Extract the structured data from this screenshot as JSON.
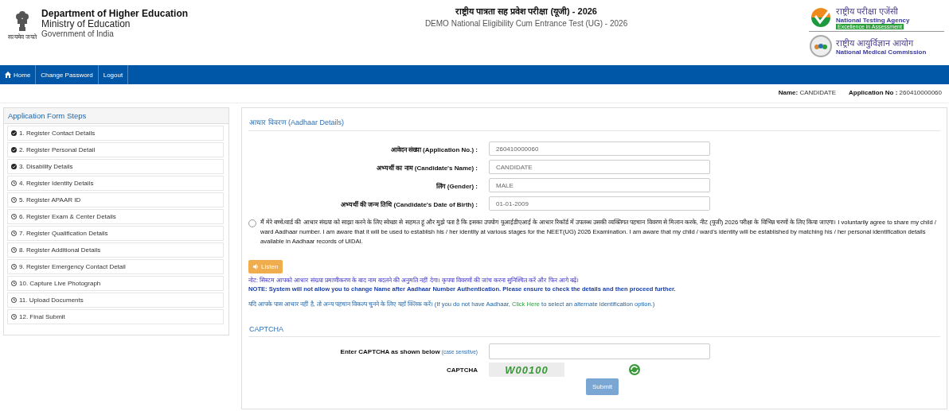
{
  "header": {
    "emblem_caption": "सत्यमेव जयते",
    "department": "Department of Higher Education",
    "ministry": "Ministry of Education",
    "government": "Government of India",
    "title_hindi": "राष्ट्रीय पात्रता सह प्रवेश परीक्षा (यूजी) - 2026",
    "title_english": "DEMO National Eligibility Cum Entrance Test (UG) - 2026",
    "nta": {
      "hindi": "राष्ट्रीय परीक्षा एजेंसी",
      "english": "National Testing Agency",
      "tagline": "Excellence in Assessment"
    },
    "nmc": {
      "hindi": "राष्ट्रीय आयुर्विज्ञान आयोग",
      "english": "National Medical Commission"
    }
  },
  "nav": [
    {
      "label": "Home",
      "kind": "home"
    },
    {
      "label": "Change Password",
      "kind": "link"
    },
    {
      "label": "Logout",
      "kind": "link"
    }
  ],
  "candidate_info": [
    {
      "label": "Name:",
      "value": "CANDIDATE"
    },
    {
      "label": "Application No :",
      "value": "260410000060"
    }
  ],
  "steps": {
    "title": "Application Form Steps",
    "items": [
      {
        "label": "1. Register Contact Details",
        "done": true
      },
      {
        "label": "2. Register Personal Detail",
        "done": true
      },
      {
        "label": "3. Disability Details",
        "done": true
      },
      {
        "label": "4. Register Identity Details",
        "done": false
      },
      {
        "label": "5. Register APAAR ID",
        "done": false
      },
      {
        "label": "6. Register Exam & Center Details",
        "done": false
      },
      {
        "label": "7. Register Qualification Details",
        "done": false
      },
      {
        "label": "8. Register Additional Details",
        "done": false
      },
      {
        "label": "9. Register Emergency Contact Detail",
        "done": false
      },
      {
        "label": "10. Capture Live Photograph",
        "done": false
      },
      {
        "label": "11. Upload Documents",
        "done": false
      },
      {
        "label": "12. Final Submit",
        "done": false
      }
    ]
  },
  "aadhaar": {
    "title": "आधार विवरण (Aadhaar Details)",
    "fields": [
      {
        "label": "आवेदन संख्या (Application No.) :",
        "value": "260410000060"
      },
      {
        "label": "अभ्यर्थी का नाम (Candidate's Name) :",
        "value": "CANDIDATE"
      },
      {
        "label": "लिंग (Gender) :",
        "value": "MALE"
      },
      {
        "label": "अभ्यर्थी की जन्म तिथि (Candidate's Date of Birth) :",
        "value": "01-01-2009"
      }
    ],
    "consent": {
      "text": "मैं मेरे बच्चे/वार्ड की आधार संख्या को साझा करने के लिए स्वेच्छा से सहमत हूं और मुझे पता है कि इसका उपयोग यूआईडीएआई के आधार रिकॉर्ड में उपलब्ध उसकी व्यक्तिगत पहचान विवरण से मिलान करके, नीट (यूजी) 2026 परीक्षा के विभिन्न चरणों के लिए किया जाएगा। I voluntarily agree to share my child / ward Aadhaar number. I am aware that it will be used to establish his / her identity at various stages for the NEET(UG) 2026 Examination. I am aware that my child / ward's identity will be established by matching his / her personal identification details available in Aadhaar records of UIDAI.",
      "checked": false
    },
    "listen_button": "Listen",
    "notes": [
      {
        "kind": "hindi",
        "text": "नोट: सिस्टम आपको आधार संख्या प्रमाणीकरण के बाद नाम बदलने की अनुमति नहीं देगा। कृपया विवरणों की जांच करना सुनिश्चित करें और फिर आगे बढ़ें।"
      },
      {
        "kind": "english",
        "text": "NOTE: System will not allow you to change Name after Aadhaar Number Authentication. Please ensure to check the details and then proceed further."
      }
    ],
    "alternate": {
      "before": "यदि आपके पास आधार नहीं है, तो अन्य पहचान विकल्प चुनने के लिए यहाँ क्लिक करें। (If you do not have Aadhaar, ",
      "link": "Click Here",
      "after": " to select an alternate identification option.)"
    }
  },
  "captcha": {
    "title": "CAPTCHA",
    "input_label": "Enter CAPTCHA as shown below",
    "hint": "(case sensitive)",
    "image_label": "CAPTCHA",
    "code": "W00100",
    "submit": "Submit"
  }
}
